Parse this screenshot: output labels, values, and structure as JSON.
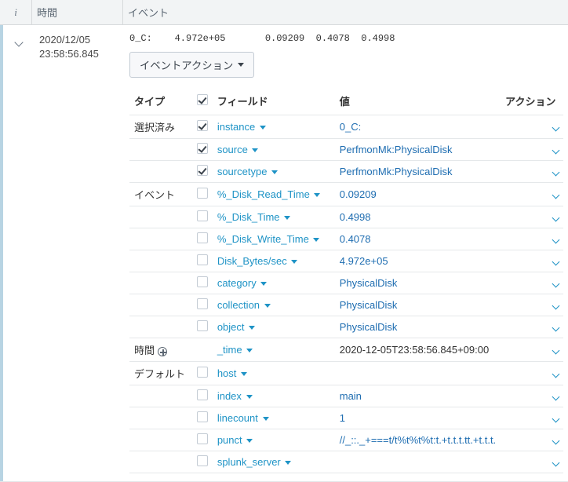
{
  "header": {
    "i": "i",
    "time": "時間",
    "event": "イベント"
  },
  "row": {
    "timestamp_date": "2020/12/05",
    "timestamp_time": "23:58:56.845",
    "raw": "0_C:    4.972e+05       0.09209  0.4078  0.4998",
    "event_action_label": "イベントアクション"
  },
  "field_headers": {
    "type": "タイプ",
    "field": "フィールド",
    "value": "値",
    "action": "アクション"
  },
  "groups": [
    {
      "label": "選択済み",
      "fields": [
        {
          "name": "instance",
          "value": "0_C:",
          "checked": true,
          "value_link": true
        },
        {
          "name": "source",
          "value": "PerfmonMk:PhysicalDisk",
          "checked": true,
          "value_link": true
        },
        {
          "name": "sourcetype",
          "value": "PerfmonMk:PhysicalDisk",
          "checked": true,
          "value_link": true
        }
      ]
    },
    {
      "label": "イベント",
      "fields": [
        {
          "name": "%_Disk_Read_Time",
          "value": "0.09209",
          "checked": false,
          "value_link": true
        },
        {
          "name": "%_Disk_Time",
          "value": "0.4998",
          "checked": false,
          "value_link": true
        },
        {
          "name": "%_Disk_Write_Time",
          "value": "0.4078",
          "checked": false,
          "value_link": true
        },
        {
          "name": "Disk_Bytes/sec",
          "value": "4.972e+05",
          "checked": false,
          "value_link": true
        },
        {
          "name": "category",
          "value": "PhysicalDisk",
          "checked": false,
          "value_link": true
        },
        {
          "name": "collection",
          "value": "PhysicalDisk",
          "checked": false,
          "value_link": true
        },
        {
          "name": "object",
          "value": "PhysicalDisk",
          "checked": false,
          "value_link": true
        }
      ]
    },
    {
      "label": "時間",
      "add_icon": true,
      "fields": [
        {
          "name": "_time",
          "value": "2020-12-05T23:58:56.845+09:00",
          "checked": null,
          "value_link": false
        }
      ]
    },
    {
      "label": "デフォルト",
      "fields": [
        {
          "name": "host",
          "value": "",
          "checked": false,
          "value_link": true
        },
        {
          "name": "index",
          "value": "main",
          "checked": false,
          "value_link": true
        },
        {
          "name": "linecount",
          "value": "1",
          "checked": false,
          "value_link": true
        },
        {
          "name": "punct",
          "value": "//_::._+===t/t%t%t%t:t.+t.t.t.tt.+t.t.t.",
          "checked": false,
          "value_link": true
        },
        {
          "name": "splunk_server",
          "value": "",
          "checked": false,
          "value_link": true
        }
      ]
    }
  ]
}
